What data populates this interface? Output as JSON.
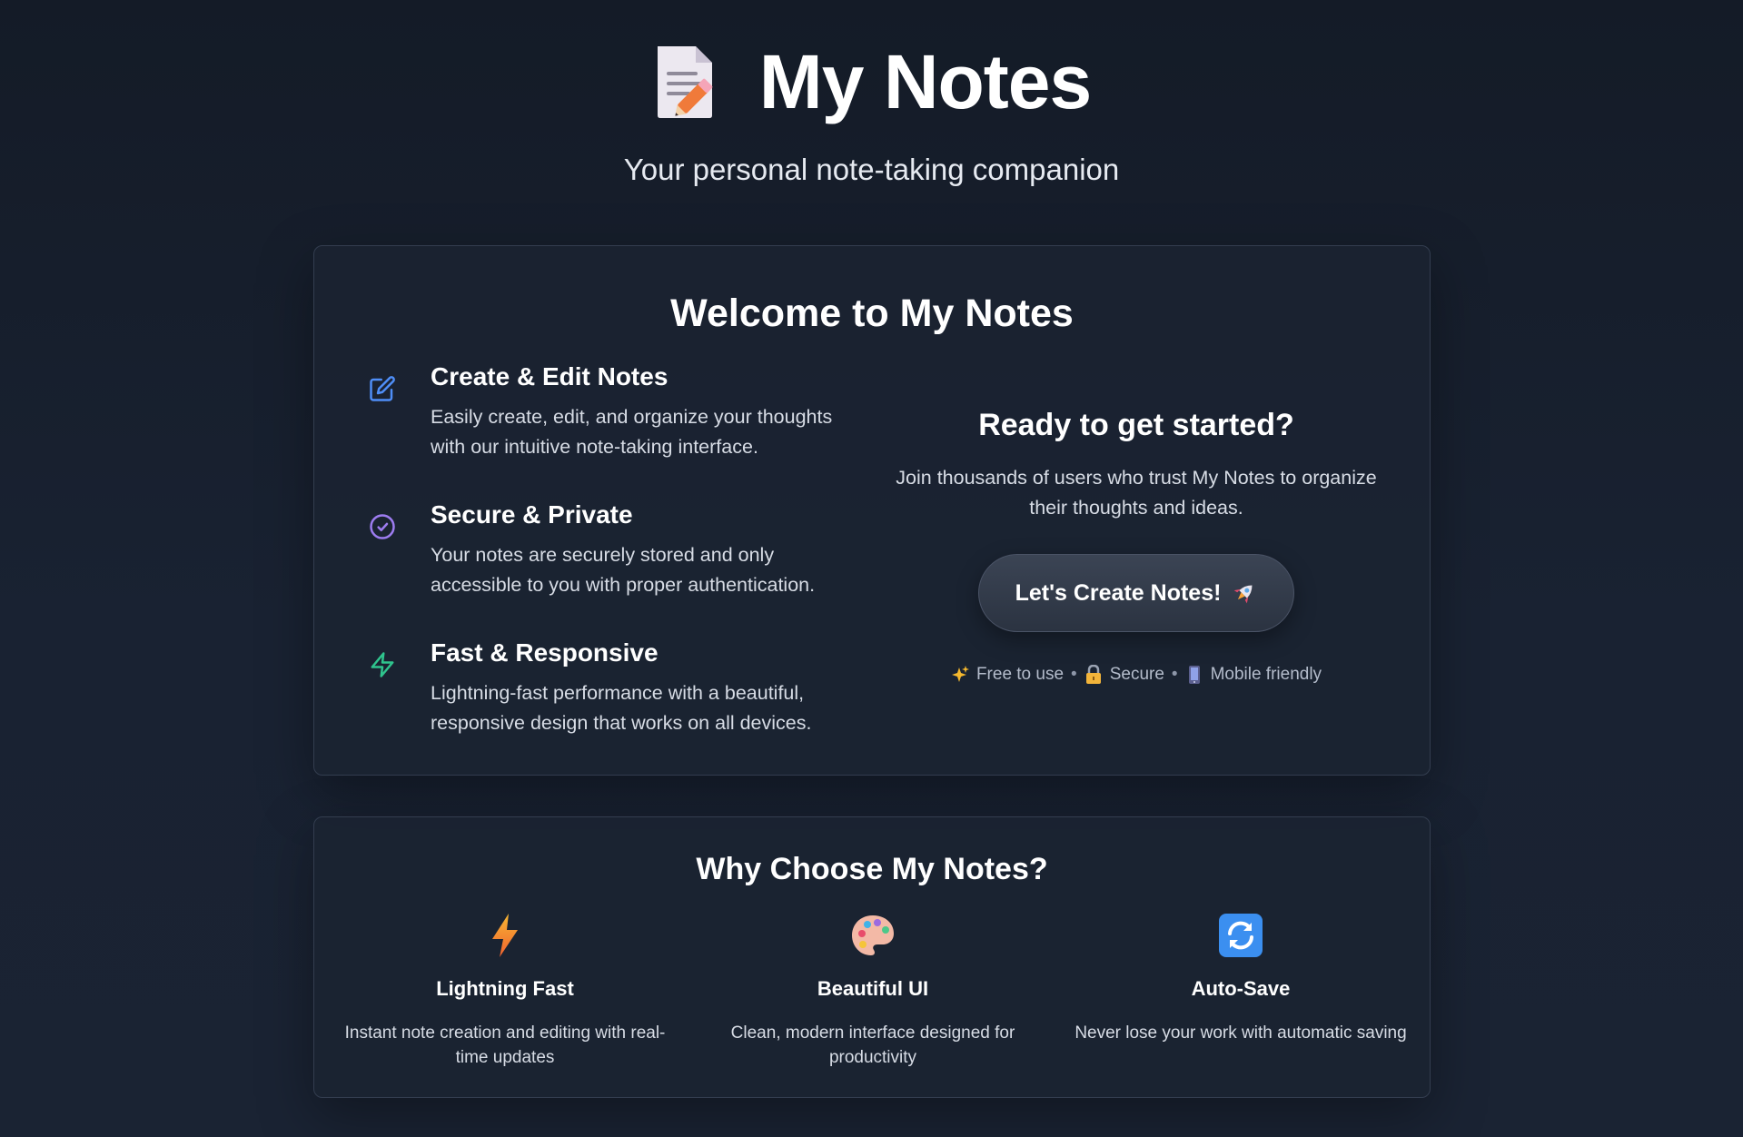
{
  "header": {
    "title": "My Notes",
    "subtitle": "Your personal note-taking companion",
    "icon": "memo-pencil-icon"
  },
  "welcome": {
    "title": "Welcome to My Notes",
    "features": [
      {
        "icon": "edit-icon",
        "title": "Create & Edit Notes",
        "description": "Easily create, edit, and organize your thoughts with our intuitive note-taking interface."
      },
      {
        "icon": "check-circle-icon",
        "title": "Secure & Private",
        "description": "Your notes are securely stored and only accessible to you with proper authentication."
      },
      {
        "icon": "lightning-icon",
        "title": "Fast & Responsive",
        "description": "Lightning-fast performance with a beautiful, responsive design that works on all devices."
      }
    ],
    "cta": {
      "title": "Ready to get started?",
      "description": "Join thousands of users who trust My Notes to organize their thoughts and ideas.",
      "button_label": "Let's Create Notes!",
      "badges": [
        "Free to use",
        "Secure",
        "Mobile friendly"
      ]
    }
  },
  "why": {
    "title": "Why Choose My Notes?",
    "items": [
      {
        "icon": "lightning-emoji-icon",
        "title": "Lightning Fast",
        "description": "Instant note creation and editing with real-time updates"
      },
      {
        "icon": "palette-icon",
        "title": "Beautiful UI",
        "description": "Clean, modern interface designed for productivity"
      },
      {
        "icon": "sync-icon",
        "title": "Auto-Save",
        "description": "Never lose your work with automatic saving"
      }
    ]
  },
  "colors": {
    "background": "#161d2a",
    "card": "#1b2331",
    "edit_icon": "#4f8ef7",
    "check_icon": "#9d7cf0",
    "lightning_icon": "#2fc48d"
  }
}
